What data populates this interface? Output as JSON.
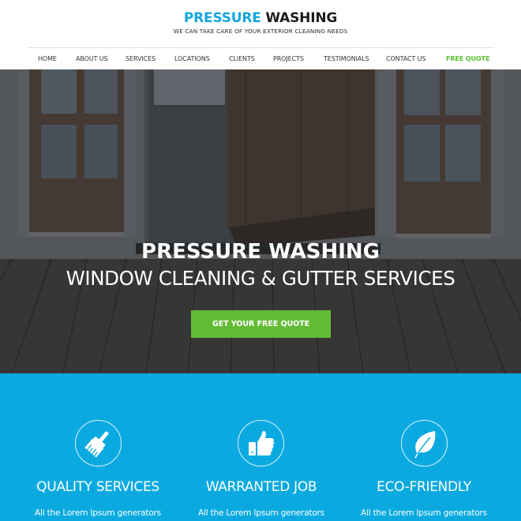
{
  "brand": {
    "title_part1": "PRESSURE",
    "title_part2": "WASHING",
    "tagline": "WE CAN TAKE CARE OF YOUR EXTERIOR CLEANING NEEDS",
    "accent_color": "#13a6df"
  },
  "nav": {
    "items": [
      {
        "label": "HOME"
      },
      {
        "label": "ABOUT US"
      },
      {
        "label": "SERVICES"
      },
      {
        "label": "LOCATIONS"
      },
      {
        "label": "CLIENTS"
      },
      {
        "label": "PROJECTS"
      },
      {
        "label": "TESTIMONIALS"
      },
      {
        "label": "CONTACT US"
      },
      {
        "label": "FREE QUOTE",
        "highlight_color": "#5bbf2c"
      }
    ]
  },
  "hero": {
    "title": "PRESSURE WASHING",
    "subtitle": "WINDOW CLEANING & GUTTER SERVICES",
    "cta_label": "GET YOUR FREE QUOTE",
    "cta_color": "#62bb35"
  },
  "features": {
    "background_color": "#0aaae0",
    "items": [
      {
        "icon": "brush-icon",
        "title": "QUALITY SERVICES",
        "text": "All the Lorem Ipsum generators"
      },
      {
        "icon": "thumbs-up-icon",
        "title": "WARRANTED JOB",
        "text": "All the Lorem Ipsum generators"
      },
      {
        "icon": "leaf-icon",
        "title": "ECO-FRIENDLY",
        "text": "All the Lorem Ipsum generators"
      }
    ]
  }
}
